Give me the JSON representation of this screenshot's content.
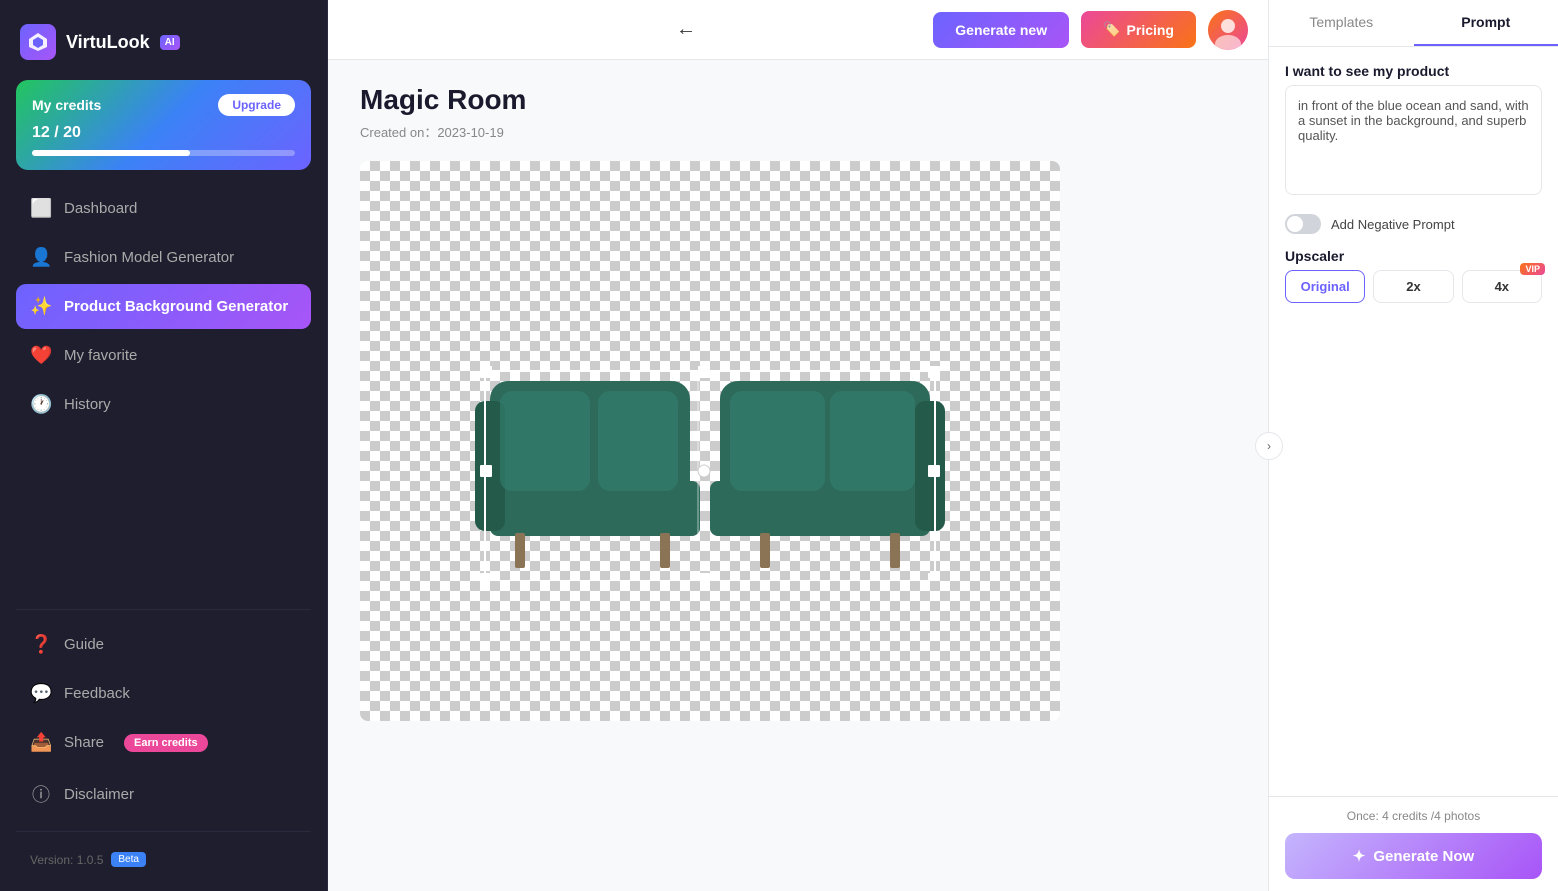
{
  "app": {
    "name": "VirtuLook",
    "badge": "AI",
    "logo_emoji": "🔷"
  },
  "sidebar": {
    "credits": {
      "label": "My credits",
      "upgrade_label": "Upgrade",
      "current": 12,
      "total": 20,
      "display": "12 / 20",
      "percent": 60
    },
    "nav_items": [
      {
        "id": "dashboard",
        "label": "Dashboard",
        "icon": "⬜",
        "active": false
      },
      {
        "id": "fashion-model",
        "label": "Fashion Model Generator",
        "icon": "👤",
        "active": false
      },
      {
        "id": "product-bg",
        "label": "Product Background Generator",
        "icon": "✨",
        "active": true
      },
      {
        "id": "my-favorite",
        "label": "My favorite",
        "icon": "❤️",
        "active": false
      },
      {
        "id": "history",
        "label": "History",
        "icon": "🕐",
        "active": false
      }
    ],
    "bottom_items": [
      {
        "id": "guide",
        "label": "Guide",
        "icon": "❓"
      },
      {
        "id": "feedback",
        "label": "Feedback",
        "icon": "💬"
      },
      {
        "id": "share",
        "label": "Share",
        "icon": "📤",
        "earn_credits": true
      }
    ],
    "disclaimer": {
      "label": "Disclaimer",
      "icon": "ⓘ"
    },
    "version": {
      "label": "Version: 1.0.5",
      "badge": "Beta"
    }
  },
  "header": {
    "generate_new_label": "Generate new",
    "pricing_label": "Pricing",
    "pricing_icon": "🏷️"
  },
  "main": {
    "back_icon": "←",
    "title": "Magic Room",
    "created_prefix": "Created on：",
    "created_date": "2023-10-19"
  },
  "right_panel": {
    "tabs": [
      {
        "id": "templates",
        "label": "Templates",
        "active": false
      },
      {
        "id": "prompt",
        "label": "Prompt",
        "active": true
      }
    ],
    "prompt_label": "I want to see my product",
    "prompt_value": "in front of the blue ocean and sand, with a sunset in the background, and superb quality.",
    "prompt_placeholder": "in front of the blue ocean and sand, with a sunset in the background, and superb quality.",
    "negative_prompt_label": "Add Negative Prompt",
    "upscaler_label": "Upscaler",
    "upscaler_options": [
      {
        "id": "original",
        "label": "Original",
        "active": true,
        "vip": false
      },
      {
        "id": "2x",
        "label": "2x",
        "active": false,
        "vip": false
      },
      {
        "id": "4x",
        "label": "4x",
        "active": false,
        "vip": true
      }
    ],
    "credits_info": "Once: 4 credits /4 photos",
    "generate_label": "Generate Now",
    "generate_icon": "✦"
  },
  "earn_credits_label": "Earn credits",
  "share_label": "Share"
}
